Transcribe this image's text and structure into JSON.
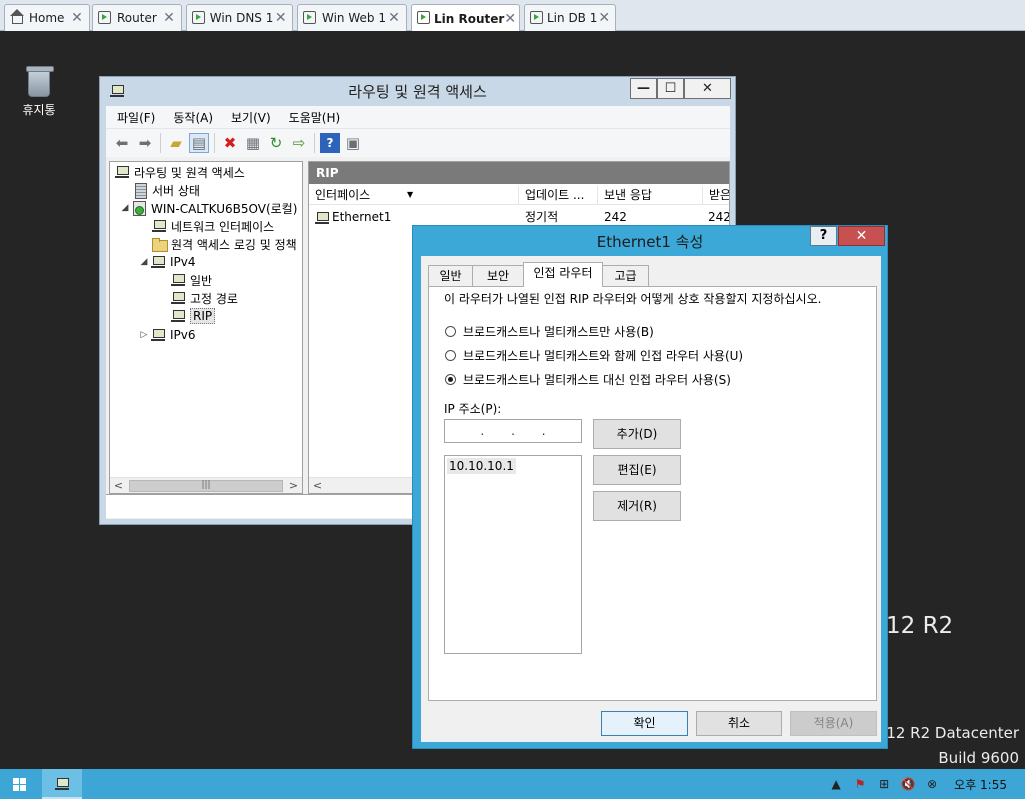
{
  "vm_tabs": [
    {
      "label": "Home",
      "icon": "home-icon"
    },
    {
      "label": "Router",
      "icon": "vm-icon"
    },
    {
      "label": "Win DNS 1",
      "icon": "vm-icon"
    },
    {
      "label": "Win Web 1",
      "icon": "vm-icon"
    },
    {
      "label": "Lin Router",
      "icon": "vm-icon",
      "active": true
    },
    {
      "label": "Lin DB 1",
      "icon": "vm-icon"
    }
  ],
  "desktop": {
    "recycle_bin_label": "휴지통",
    "watermark_partial": "12 R2",
    "watermark_edition": "2012 R2 Datacenter",
    "watermark_build": "Build 9600"
  },
  "rras": {
    "title": "라우팅 및 원격 액세스",
    "window_buttons": {
      "minimize": "—",
      "maximize": "☐",
      "close": "✕"
    },
    "menu": [
      "파일(F)",
      "동작(A)",
      "보기(V)",
      "도움말(H)"
    ],
    "tree": [
      {
        "label": "라우팅 및 원격 액세스",
        "icon": "network-icon",
        "level": 0
      },
      {
        "label": "서버 상태",
        "icon": "server-status-icon",
        "level": 1
      },
      {
        "label": "WIN-CALTKU6B5OV(로컬)",
        "icon": "server-icon",
        "level": 1,
        "expander": "◢"
      },
      {
        "label": "네트워크 인터페이스",
        "icon": "network-icon",
        "level": 2
      },
      {
        "label": "원격 액세스 로깅 및 정책",
        "icon": "folder-icon",
        "level": 2
      },
      {
        "label": "IPv4",
        "icon": "network-icon",
        "level": 2,
        "expander": "◢"
      },
      {
        "label": "일반",
        "icon": "network-icon",
        "level": 3
      },
      {
        "label": "고정 경로",
        "icon": "network-icon",
        "level": 3
      },
      {
        "label": "RIP",
        "icon": "network-icon",
        "level": 3,
        "selected": true
      },
      {
        "label": "IPv6",
        "icon": "network-icon",
        "level": 2,
        "expander": "▷"
      }
    ],
    "list_title": "RIP",
    "columns": [
      "인터페이스",
      "업데이트 ...",
      "보낸 응답",
      "받은"
    ],
    "rows": [
      {
        "interface": "Ethernet1",
        "update": "정기적",
        "sent": "242",
        "received": "242"
      }
    ]
  },
  "dialog": {
    "title": "Ethernet1 속성",
    "help": "?",
    "close": "✕",
    "tabs": [
      "일반",
      "보안",
      "인접 라우터",
      "고급"
    ],
    "active_tab": "인접 라우터",
    "description": "이 라우터가 나열된 인접 RIP 라우터와 어떻게 상호 작용할지 지정하십시오.",
    "options": [
      {
        "label": "브로드캐스트나 멀티캐스트만 사용(B)",
        "selected": false
      },
      {
        "label": "브로드캐스트나 멀티캐스트와 함께 인접 라우터 사용(U)",
        "selected": false
      },
      {
        "label": "브로드캐스트나 멀티캐스트 대신 인접 라우터 사용(S)",
        "selected": true
      }
    ],
    "ip_label": "IP 주소(P):",
    "ip_input_dots": [
      ".",
      ".",
      "."
    ],
    "ip_list": [
      "10.10.10.1"
    ],
    "buttons": {
      "add": "추가(D)",
      "edit": "편집(E)",
      "remove": "제거(R)"
    },
    "footer": {
      "ok": "확인",
      "cancel": "취소",
      "apply": "적용(A)"
    }
  },
  "taskbar": {
    "clock": "오후 1:55",
    "accent": "#3da6d6"
  }
}
